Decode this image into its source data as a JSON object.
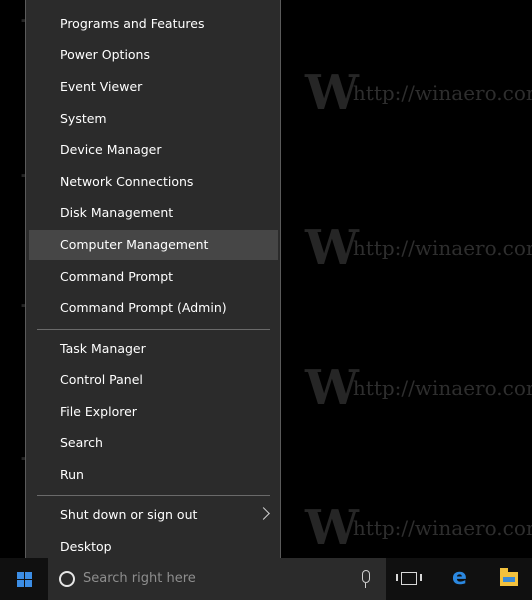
{
  "watermark": {
    "logo": "W",
    "url": "http://winaero.com"
  },
  "menu": {
    "items": [
      "Programs and Features",
      "Power Options",
      "Event Viewer",
      "System",
      "Device Manager",
      "Network Connections",
      "Disk Management",
      "Computer Management",
      "Command Prompt",
      "Command Prompt (Admin)",
      "Task Manager",
      "Control Panel",
      "File Explorer",
      "Search",
      "Run",
      "Shut down or sign out",
      "Desktop"
    ],
    "highlighted": "Computer Management"
  },
  "taskbar": {
    "search_placeholder": "Search right here",
    "icons": [
      "start-icon",
      "cortana-icon",
      "microphone-icon",
      "task-view-icon",
      "edge-icon",
      "file-explorer-icon"
    ],
    "accent_color": "#3c8ee6"
  }
}
